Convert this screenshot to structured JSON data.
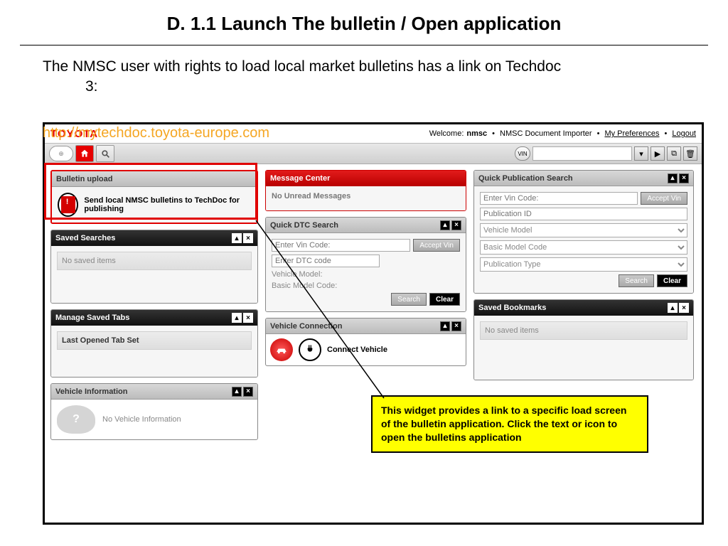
{
  "slide": {
    "title": "D. 1.1 Launch The bulletin / Open application",
    "intro_l1": "The NMSC user with rights to load local market bulletins has a link on Techdoc",
    "intro_l2": "3:",
    "url": "http://mytechdoc.toyota-europe.com"
  },
  "topbar": {
    "brand": "TOYOTA",
    "welcome": "Welcome:",
    "user": "nmsc",
    "role": "NMSC Document Importer",
    "prefs": "My Preferences",
    "logout": "Logout"
  },
  "vinbadge": "VIN",
  "bulletin": {
    "header": "Bulletin upload",
    "text": "Send local NMSC bulletins to TechDoc for publishing"
  },
  "message_center": {
    "header": "Message Center",
    "body": "No Unread Messages"
  },
  "saved_searches": {
    "header": "Saved Searches",
    "body": "No saved items"
  },
  "dtc": {
    "header": "Quick DTC Search",
    "vin_ph": "Enter Vin Code:",
    "dtc_ph": "Enter DTC code",
    "vm": "Vehicle Model:",
    "bmc": "Basic Model Code:",
    "accept": "Accept Vin",
    "search": "Search",
    "clear": "Clear"
  },
  "pubsearch": {
    "header": "Quick Publication Search",
    "vin_ph": "Enter Vin Code:",
    "pubid_ph": "Publication ID",
    "vm": "Vehicle Model",
    "bmc": "Basic Model Code",
    "ptype": "Publication Type",
    "accept": "Accept Vin",
    "search": "Search",
    "clear": "Clear"
  },
  "bookmarks": {
    "header": "Saved Bookmarks",
    "body": "No saved items"
  },
  "tabs": {
    "header": "Manage Saved Tabs",
    "row": "Last Opened Tab Set"
  },
  "vconn": {
    "header": "Vehicle Connection",
    "label": "Connect Vehicle"
  },
  "vinfo": {
    "header": "Vehicle Information",
    "body": "No Vehicle Information"
  },
  "callout": "This widget provides a link to a specific load screen of the bulletin application. Click the text or icon to open the bulletins application"
}
